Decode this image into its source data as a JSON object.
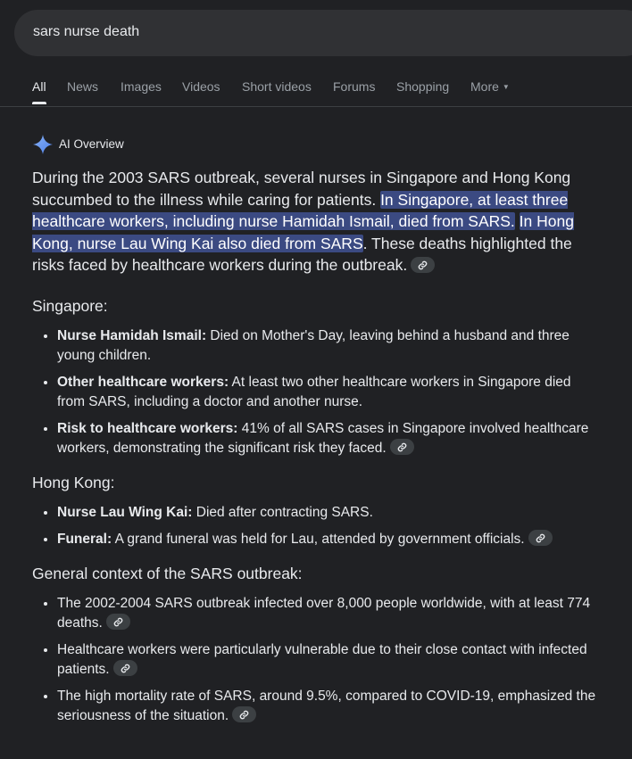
{
  "search": {
    "query": "sars nurse death"
  },
  "tabs": [
    {
      "label": "All",
      "active": true
    },
    {
      "label": "News"
    },
    {
      "label": "Images"
    },
    {
      "label": "Videos"
    },
    {
      "label": "Short videos"
    },
    {
      "label": "Forums"
    },
    {
      "label": "Shopping"
    },
    {
      "label": "More"
    }
  ],
  "ai_overview": {
    "title": "AI Overview",
    "intro": {
      "plain1": "During the 2003 SARS outbreak, several nurses in Singapore and Hong Kong succumbed to the illness while caring for patients. ",
      "highlight1": "In Singapore, at least three healthcare workers, including nurse Hamidah Ismail, died from SARS.",
      "highlight2": "In Hong Kong, nurse Lau Wing Kai also died from SARS",
      "plain2": ". These deaths highlighted the risks faced by healthcare workers during the outbreak."
    },
    "sections": [
      {
        "heading": "Singapore:",
        "items": [
          {
            "bold": "Nurse Hamidah Ismail:",
            "text": " Died on Mother's Day, leaving behind a husband and three young children."
          },
          {
            "bold": "Other healthcare workers:",
            "text": " At least two other healthcare workers in Singapore died from SARS, including a doctor and another nurse."
          },
          {
            "bold": "Risk to healthcare workers:",
            "text": " 41% of all SARS cases in Singapore involved healthcare workers, demonstrating the significant risk they faced."
          }
        ]
      },
      {
        "heading": "Hong Kong:",
        "items": [
          {
            "bold": "Nurse Lau Wing Kai:",
            "text": " Died after contracting SARS."
          },
          {
            "bold": "Funeral:",
            "text": " A grand funeral was held for Lau, attended by government officials."
          }
        ]
      },
      {
        "heading": "General context of the SARS outbreak:",
        "items": [
          {
            "text": "The 2002-2004 SARS outbreak infected over 8,000 people worldwide, with at least 774 deaths."
          },
          {
            "text": "Healthcare workers were particularly vulnerable due to their close contact with infected patients."
          },
          {
            "text": "The high mortality rate of SARS, around 9.5%, compared to COVID-19, emphasized the seriousness of the situation."
          }
        ]
      }
    ]
  },
  "colors": {
    "background": "#202124",
    "highlight": "#3b4a82",
    "sparkle_blue": "#8ab4f8"
  },
  "icons": {
    "sparkle": "ai-sparkle-icon",
    "link": "link-icon",
    "caret": "caret-down-icon"
  }
}
